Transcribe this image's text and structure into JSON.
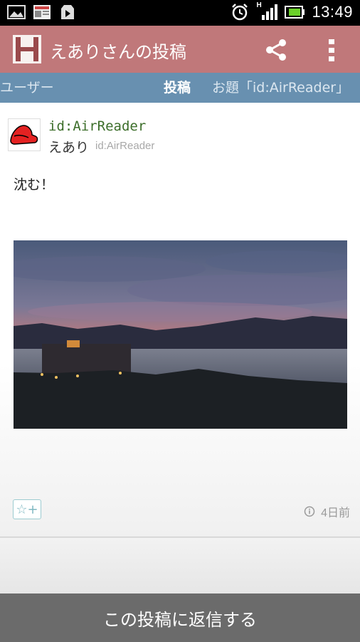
{
  "status_bar": {
    "time": "13:49",
    "network_label": "H"
  },
  "action_bar": {
    "logo_letter": "H",
    "title": "えありさんの投稿"
  },
  "tabs": [
    {
      "label": "ユーザー"
    },
    {
      "label": "投稿"
    },
    {
      "label": "お題「id:AirReader」"
    }
  ],
  "post": {
    "user_id_link": "id:AirReader",
    "display_name": "えあり",
    "user_id_sub": "id:AirReader",
    "body": "沈む！",
    "star_button": "☆+",
    "timestamp": "4日前"
  },
  "reply_button": "この投稿に返信する",
  "colors": {
    "action_bar": "#c0787a",
    "tab_bar": "#6890b0",
    "reply_bar": "#6b6b6b",
    "link_green": "#3c6e2a"
  }
}
